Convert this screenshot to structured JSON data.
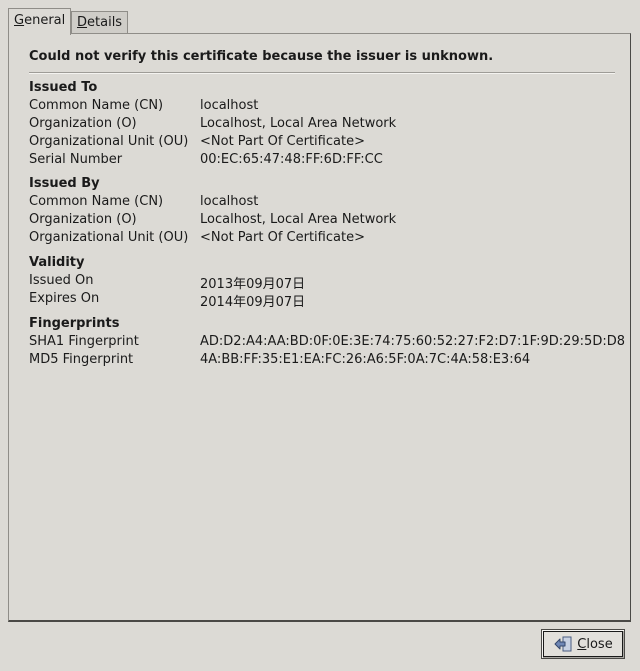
{
  "tabs": {
    "general": {
      "mnemonic": "G",
      "rest": "eneral"
    },
    "details": {
      "mnemonic": "D",
      "rest": "etails"
    }
  },
  "headline": "Could not verify this certificate because the issuer is unknown.",
  "issued_to": {
    "title": "Issued To",
    "rows": [
      {
        "label": "Common Name (CN)",
        "value": "localhost"
      },
      {
        "label": "Organization (O)",
        "value": "Localhost, Local Area Network"
      },
      {
        "label": "Organizational Unit (OU)",
        "value": "<Not Part Of Certificate>"
      },
      {
        "label": "Serial Number",
        "value": "00:EC:65:47:48:FF:6D:FF:CC"
      }
    ]
  },
  "issued_by": {
    "title": "Issued By",
    "rows": [
      {
        "label": "Common Name (CN)",
        "value": "localhost"
      },
      {
        "label": "Organization (O)",
        "value": "Localhost, Local Area Network"
      },
      {
        "label": "Organizational Unit (OU)",
        "value": "<Not Part Of Certificate>"
      }
    ]
  },
  "validity": {
    "title": "Validity",
    "rows": [
      {
        "label": "Issued On",
        "value": "2013年09月07日"
      },
      {
        "label": "Expires On",
        "value": "2014年09月07日"
      }
    ]
  },
  "fingerprints": {
    "title": "Fingerprints",
    "rows": [
      {
        "label": "SHA1 Fingerprint",
        "value": "AD:D2:A4:AA:BD:0F:0E:3E:74:75:60:52:27:F2:D7:1F:9D:29:5D:D8"
      },
      {
        "label": "MD5 Fingerprint",
        "value": "4A:BB:FF:35:E1:EA:FC:26:A6:5F:0A:7C:4A:58:E3:64"
      }
    ]
  },
  "close_button": {
    "mnemonic": "C",
    "rest": "lose",
    "icon": "close-door-arrow-icon"
  }
}
